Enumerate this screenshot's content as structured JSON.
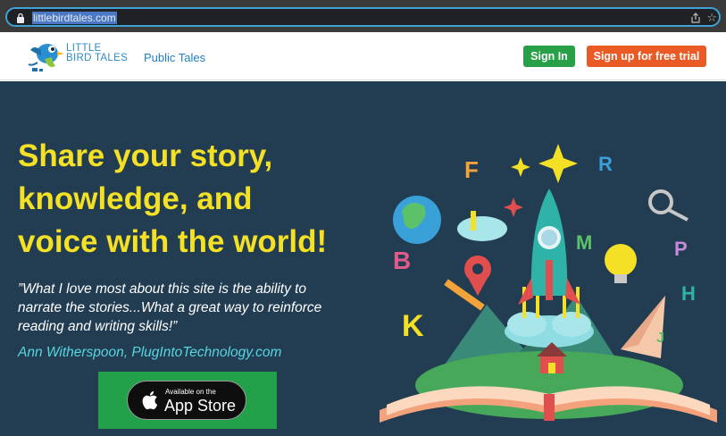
{
  "browser": {
    "url": "littlebirdtales.com",
    "icons": [
      "lock-icon",
      "share-icon",
      "star-icon"
    ]
  },
  "header": {
    "logo": {
      "line1": "LITTLE",
      "line2": "BIRD TALES"
    },
    "nav_public_tales": "Public Tales",
    "signin_label": "Sign In",
    "signup_label": "Sign up for free trial"
  },
  "hero": {
    "headline_lines": [
      "Share your story,",
      "knowledge, and",
      "voice with the world!"
    ],
    "quote_lines": [
      "”What I love most about this site is the ability to",
      "narrate the stories...What a great way to reinforce",
      "reading and writing skills!”"
    ],
    "author": "Ann Witherspoon, PlugIntoTechnology.com",
    "appstore": {
      "small": "Available on the",
      "big": "App Store"
    }
  },
  "colors": {
    "hero_bg": "#223d52",
    "headline": "#f4e025",
    "author": "#56d6e0",
    "signin": "#27a047",
    "signup": "#ea5a25",
    "brand_blue": "#2e8bc7"
  }
}
